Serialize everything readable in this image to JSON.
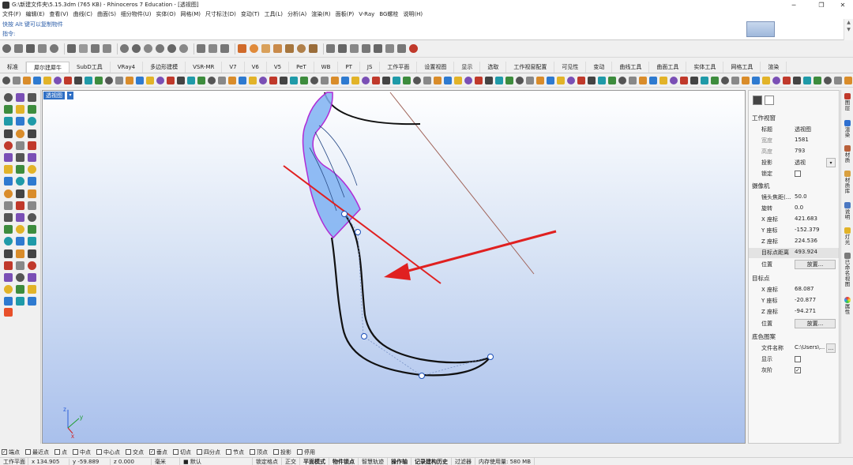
{
  "window": {
    "title": "G:\\新建文件夹\\5.15.3dm (765 KB) - Rhinoceros 7 Education - [透视图]",
    "minimize": "─",
    "maximize": "❐",
    "close": "✕"
  },
  "menu": [
    "文件(F)",
    "编辑(E)",
    "查看(V)",
    "曲线(C)",
    "曲面(S)",
    "细分物件(U)",
    "实体(O)",
    "网格(M)",
    "尺寸标注(D)",
    "变动(T)",
    "工具(L)",
    "分析(A)",
    "渲染(R)",
    "面板(P)",
    "V-Ray",
    "BG螺栓",
    "说明(H)"
  ],
  "command": {
    "history": "快按 Alt 键可以复制物件",
    "prompt": "指令:"
  },
  "tabs": [
    "标准",
    "犀尔建犀牛",
    "SubD工具",
    "VRay4",
    "多边形建模",
    "VSR-MR",
    "V7",
    "V6",
    "V5",
    "PeT",
    "WB",
    "PT",
    "JS",
    "工作平面",
    "设置视图",
    "显示",
    "选取",
    "工作视窗配置",
    "可见性",
    "变动",
    "曲线工具",
    "曲面工具",
    "实体工具",
    "网格工具",
    "渲染"
  ],
  "active_tab": "犀尔建犀牛",
  "viewport": {
    "label": "透视图",
    "dropdown": "▾",
    "axes": {
      "x": "x",
      "y": "y",
      "z": "z"
    }
  },
  "properties": {
    "section_viewport": "工作视窗",
    "title_label": "标题",
    "title_value": "透视图",
    "width_label": "宽度",
    "width_value": "1581",
    "height_label": "高度",
    "height_value": "793",
    "projection_label": "投影",
    "projection_value": "透视",
    "lock_label": "锁定",
    "lock_checked": false,
    "section_camera": "摄像机",
    "lens_label": "镜头焦距(...",
    "lens_value": "50.0",
    "rotate_label": "旋转",
    "rotate_value": "0.0",
    "cam_x_label": "X 座标",
    "cam_x_value": "421.683",
    "cam_y_label": "Y 座标",
    "cam_y_value": "-152.379",
    "cam_z_label": "Z 座标",
    "cam_z_value": "224.536",
    "target_dist_label": "目标点距离",
    "target_dist_value": "493.924",
    "cam_pos_label": "位置",
    "cam_pos_button": "放置...",
    "section_target": "目标点",
    "tgt_x_label": "X 座标",
    "tgt_x_value": "68.087",
    "tgt_y_label": "Y 座标",
    "tgt_y_value": "-20.877",
    "tgt_z_label": "Z 座标",
    "tgt_z_value": "-94.271",
    "tgt_pos_label": "位置",
    "tgt_pos_button": "放置...",
    "section_wallpaper": "底色图案",
    "filename_label": "文件名称",
    "filename_value": "C:\\Users\\...",
    "browse_button": "...",
    "show_label": "显示",
    "show_checked": false,
    "gray_label": "灰阶",
    "gray_checked": true
  },
  "side_tabs": [
    "图层",
    "渲染",
    "材质",
    "材质库",
    "说明",
    "灯光",
    "已命名视图",
    "属性"
  ],
  "osnaps": [
    {
      "label": "端点",
      "checked": true
    },
    {
      "label": "最近点",
      "checked": false
    },
    {
      "label": "点",
      "checked": false
    },
    {
      "label": "中点",
      "checked": false
    },
    {
      "label": "中心点",
      "checked": false
    },
    {
      "label": "交点",
      "checked": false
    },
    {
      "label": "垂点",
      "checked": true
    },
    {
      "label": "切点",
      "checked": false
    },
    {
      "label": "四分点",
      "checked": false
    },
    {
      "label": "节点",
      "checked": false
    },
    {
      "label": "顶点",
      "checked": false
    },
    {
      "label": "投影",
      "checked": false
    },
    {
      "label": "停用",
      "checked": false
    }
  ],
  "status": {
    "cplane": "工作平面",
    "x": "x 134.905",
    "y": "y -59.889",
    "z": "z 0.000",
    "unit": "毫米",
    "layer": "■ 默认",
    "grid_snap": "锁定格点",
    "ortho": "正交",
    "planar": "平面模式",
    "osnap": "物件锁点",
    "smarttrack": "智慧轨迹",
    "gumball": "操作轴",
    "history": "记录建构历史",
    "filter": "过滤器",
    "memory": "内存使用量: 580 MB"
  }
}
